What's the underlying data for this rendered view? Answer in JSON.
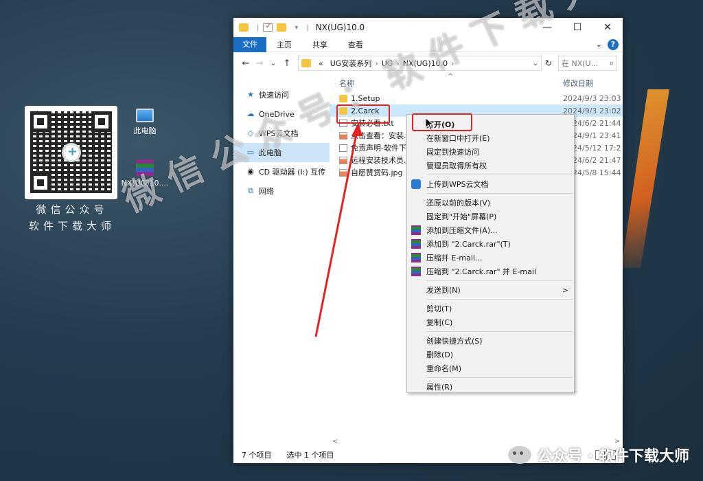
{
  "desktop": {
    "qr_caption_line1": "微信公众号",
    "qr_caption_line2": "软件下载大师",
    "icons": [
      {
        "label": "此电脑",
        "icon": "computer-icon"
      },
      {
        "label": "NX(UG)10....",
        "icon": "winrar-archive-icon"
      }
    ]
  },
  "window": {
    "title": "NX(UG)10.0",
    "controls": {
      "minimize": "—",
      "maximize": "☐",
      "close": "✕"
    },
    "ribbon_tabs": [
      "文件",
      "主页",
      "共享",
      "查看"
    ],
    "ribbon_expand": "⌄",
    "help": "?",
    "nav": {
      "back": "←",
      "forward": "→",
      "recent": "⌄",
      "up": "↑"
    },
    "breadcrumb": [
      "«",
      "UG安装系列",
      "UG",
      "NX(UG)10.0"
    ],
    "address_dropdown": "⌄",
    "refresh": "↻",
    "search_placeholder": "在 NX(U...",
    "search_icon": "⌕"
  },
  "nav_pane": [
    {
      "label": "快速访问",
      "icon": "star-icon"
    },
    {
      "label": "OneDrive",
      "icon": "onedrive-icon"
    },
    {
      "label": "WPS云文档",
      "icon": "wps-cloud-icon"
    },
    {
      "label": "此电脑",
      "icon": "this-pc-icon",
      "selected": true
    },
    {
      "label": "CD 驱动器 (I:) 互传",
      "icon": "cd-drive-icon"
    },
    {
      "label": "网络",
      "icon": "network-icon"
    }
  ],
  "columns": {
    "name": "名称",
    "date": "修改日期",
    "sort_indicator": "^"
  },
  "files": [
    {
      "name": "1.Setup",
      "date": "2024/9/3 23:03",
      "type": "folder"
    },
    {
      "name": "2.Carck",
      "date": "2024/9/3 23:02",
      "type": "folder",
      "selected": true
    },
    {
      "name": "安装必看.txt",
      "date": "2024/6/2 21:44",
      "type": "txt"
    },
    {
      "name": "点击查看：安装...",
      "date": "2024/9/1 23:41",
      "type": "jpg"
    },
    {
      "name": "免责声明-软件下...",
      "date": "2024/5/12 17:2",
      "type": "txt"
    },
    {
      "name": "远程安装技术员.jp...",
      "date": "2024/6/2 21:47",
      "type": "jpg"
    },
    {
      "name": "自愿赞赏码.jpg",
      "date": "2024/5/8 15:44",
      "type": "jpg"
    }
  ],
  "status": {
    "count": "7 个项目",
    "selected": "选中 1 个项目"
  },
  "scroll": {
    "left": "<",
    "right": ">"
  },
  "context_menu": {
    "groups": [
      [
        {
          "label": "打开(O)",
          "bold": true
        },
        {
          "label": "在新窗口中打开(E)"
        },
        {
          "label": "固定到快速访问"
        },
        {
          "label": "管理员取得所有权"
        }
      ],
      [
        {
          "label": "上传到WPS云文档",
          "icon": "wps-upload-icon"
        }
      ],
      [
        {
          "label": "还原以前的版本(V)"
        },
        {
          "label": "固定到\"开始\"屏幕(P)"
        },
        {
          "label": "添加到压缩文件(A)...",
          "icon": "winrar-icon"
        },
        {
          "label": "添加到 \"2.Carck.rar\"(T)",
          "icon": "winrar-icon"
        },
        {
          "label": "压缩并 E-mail...",
          "icon": "winrar-icon"
        },
        {
          "label": "压缩到 \"2.Carck.rar\" 并 E-mail",
          "icon": "winrar-icon"
        }
      ],
      [
        {
          "label": "发送到(N)",
          "submenu": true
        }
      ],
      [
        {
          "label": "剪切(T)"
        },
        {
          "label": "复制(C)"
        }
      ],
      [
        {
          "label": "创建快捷方式(S)"
        },
        {
          "label": "删除(D)"
        },
        {
          "label": "重命名(M)"
        }
      ],
      [
        {
          "label": "属性(R)"
        }
      ]
    ],
    "submenu_arrow": ">"
  },
  "watermarks": {
    "diagonal": "微信公众号：软件下载大师",
    "bottom": "公众号 · 软件下载大师"
  },
  "colors": {
    "ribbon_file_tab": "#1a6fc4",
    "selection": "#cce8ff",
    "annotation_red": "#e32222"
  }
}
